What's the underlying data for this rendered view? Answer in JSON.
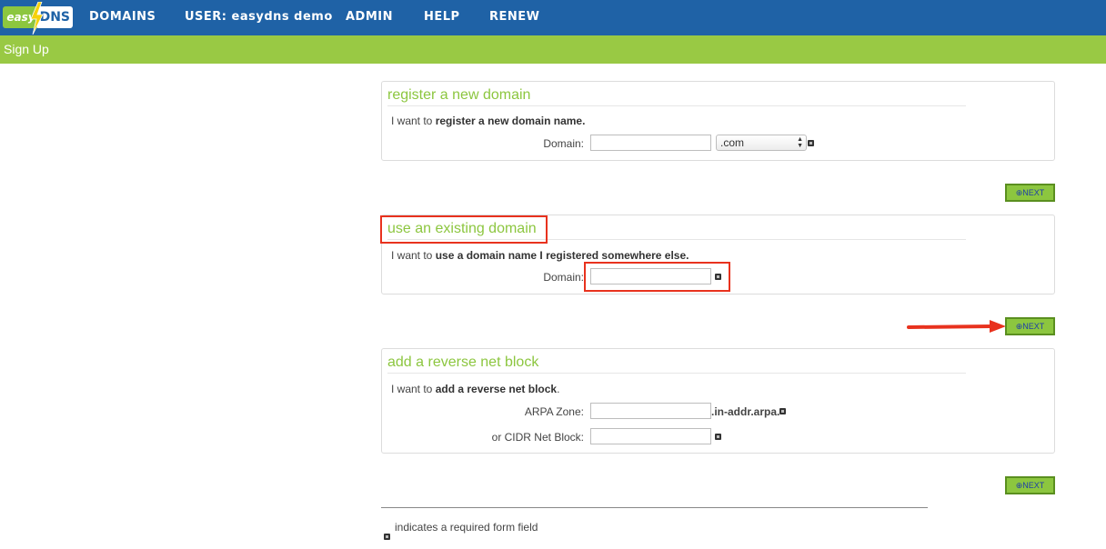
{
  "nav": {
    "logo_easy": "easy",
    "logo_dns": "DNS",
    "items": [
      "DOMAINS",
      "USER: easydns demo",
      "ADMIN",
      "HELP",
      "RENEW"
    ]
  },
  "subbar": {
    "title": "Sign Up"
  },
  "register": {
    "heading": "register a new domain",
    "intro_prefix": "I want to ",
    "intro_bold": "register a new domain name.",
    "domain_label": "Domain:",
    "domain_value": "",
    "tld_selected": ".com"
  },
  "existing": {
    "heading": "use an existing domain",
    "intro_prefix": "I want to ",
    "intro_bold": "use a domain name I registered somewhere else.",
    "domain_label": "Domain:",
    "domain_value": ""
  },
  "reverse": {
    "heading": "add a reverse net block",
    "intro_prefix": "I want to ",
    "intro_bold": "add a reverse net block",
    "intro_suffix": ".",
    "arpa_label": "ARPA Zone:",
    "arpa_suffix": ".in-addr.arpa.",
    "cidr_label": "or CIDR Net Block:"
  },
  "buttons": {
    "next_label": "⊕NEXT"
  },
  "footer": {
    "note": "indicates a required form field"
  },
  "colors": {
    "nav_blue": "#1f62a6",
    "green": "#99c944",
    "heading_green": "#8cc63f",
    "highlight_red": "#e8321e"
  }
}
